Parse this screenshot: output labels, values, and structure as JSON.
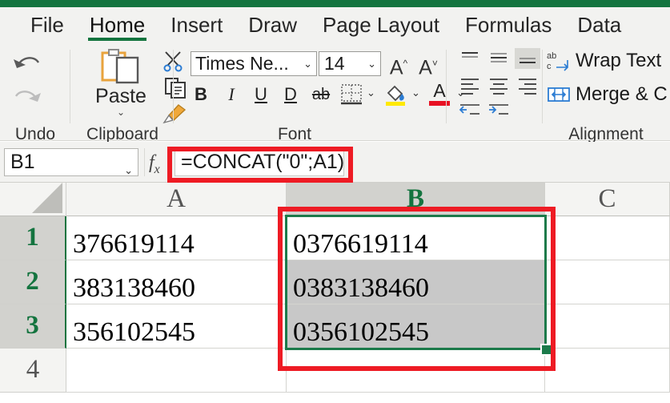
{
  "app": {
    "accent_green": "#14743F",
    "annotation_red": "#EE1B24",
    "selection_green": "#1C7A4A"
  },
  "tabs": [
    {
      "label": "File",
      "active": false
    },
    {
      "label": "Home",
      "active": true
    },
    {
      "label": "Insert",
      "active": false
    },
    {
      "label": "Draw",
      "active": false
    },
    {
      "label": "Page Layout",
      "active": false
    },
    {
      "label": "Formulas",
      "active": false
    },
    {
      "label": "Data",
      "active": false
    }
  ],
  "ribbon": {
    "groups": [
      {
        "label": "Undo"
      },
      {
        "label": "Clipboard"
      },
      {
        "label": "Font"
      },
      {
        "label": "Alignment"
      }
    ],
    "undo": {
      "undo_icon": "undo-arrow-icon",
      "redo_icon": "redo-arrow-icon"
    },
    "clipboard": {
      "paste_label": "Paste",
      "paste_caret": "⌄",
      "paste_icon": "clipboard-paste-icon",
      "cut_icon": "scissors-icon",
      "copy_icon": "copy-icon",
      "format_painter_icon": "format-painter-brush-icon"
    },
    "font": {
      "font_name": "Times Ne...",
      "font_size": "14",
      "caret": "⌄",
      "grow_font": "A",
      "shrink_font": "A",
      "bold": "B",
      "italic": "I",
      "underline": "U",
      "double_underline": "D",
      "strikethrough": "ab",
      "borders_icon": "borders-icon",
      "fill_color_icon": "fill-color-icon",
      "fill_color": "#FFE900",
      "font_color_letter": "A",
      "font_color": "#E81123"
    },
    "alignment": {
      "wrap_text_label": "Wrap Text",
      "merge_center_label": "Merge & C",
      "wrap_text_icon": "wrap-text-icon",
      "merge_center_icon": "merge-center-icon",
      "align_top_icon": "align-top-icon",
      "align_middle_icon": "align-middle-icon",
      "align_bottom_icon": "align-bottom-icon",
      "align_left_icon": "align-left-icon",
      "align_center_icon": "align-center-icon",
      "align_right_icon": "align-right-icon",
      "decrease_indent_icon": "decrease-indent-icon",
      "increase_indent_icon": "increase-indent-icon"
    }
  },
  "formula_bar": {
    "name_box_value": "B1",
    "name_box_caret": "⌄",
    "fx_label": "fx",
    "formula_value": "=CONCAT(\"0\";A1)"
  },
  "sheet": {
    "columns": [
      {
        "label": "A",
        "selected": false
      },
      {
        "label": "B",
        "selected": true
      },
      {
        "label": "C",
        "selected": false
      }
    ],
    "rows": [
      {
        "label": "1",
        "selected": true
      },
      {
        "label": "2",
        "selected": true
      },
      {
        "label": "3",
        "selected": true
      },
      {
        "label": "4",
        "selected": false
      }
    ],
    "cells": {
      "A1": "376619114",
      "A2": "383138460",
      "A3": "356102545",
      "A4": "",
      "B1": "0376619114",
      "B2": "0383138460",
      "B3": "0356102545",
      "B4": "",
      "C1": "",
      "C2": "",
      "C3": "",
      "C4": ""
    },
    "active_cell": "B1",
    "selected_range": "B1:B3"
  }
}
